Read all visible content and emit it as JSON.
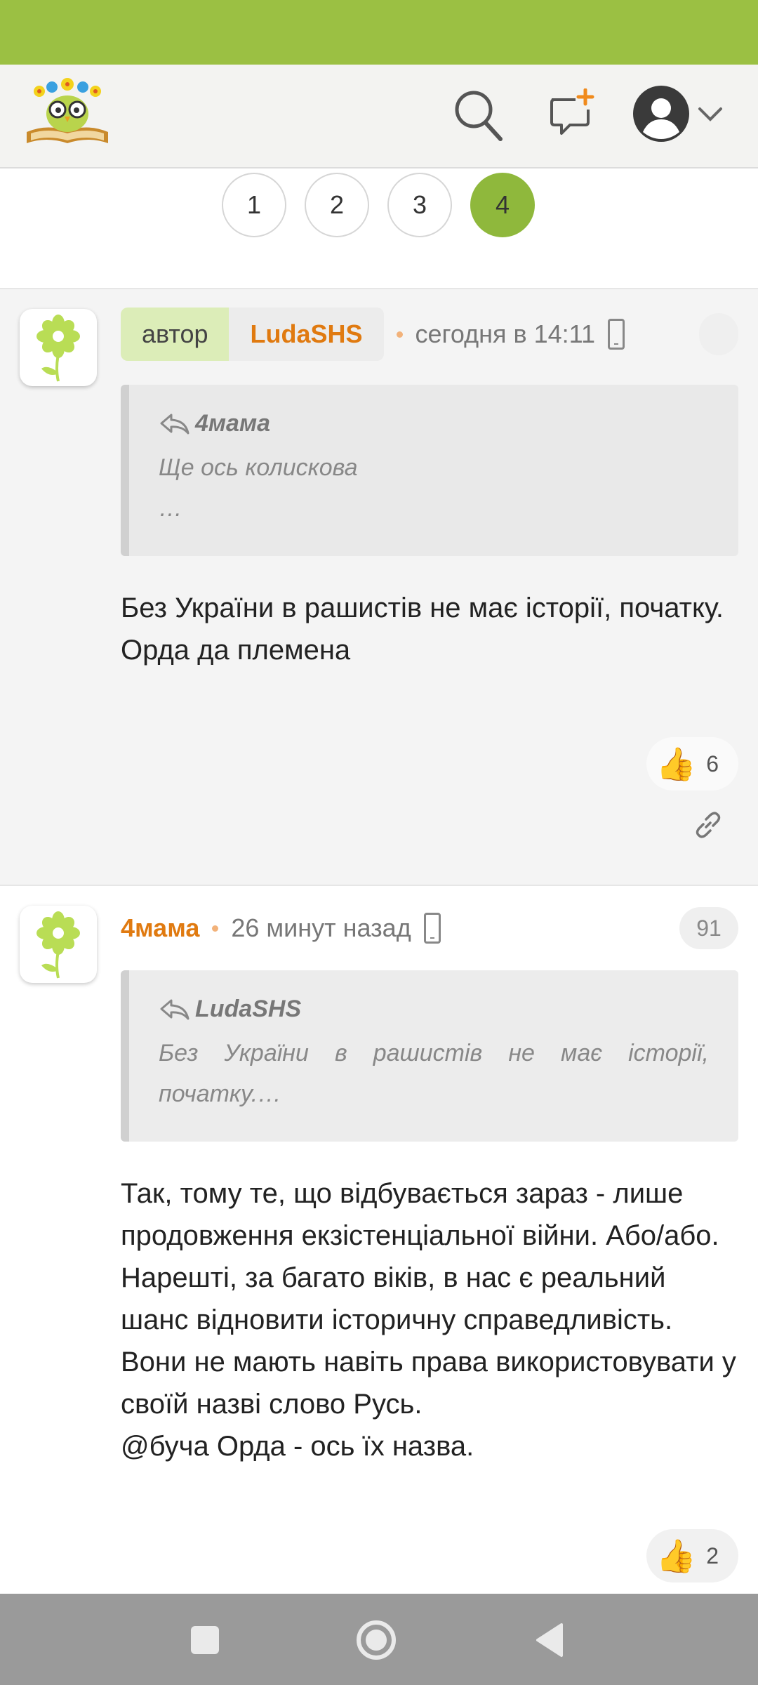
{
  "colors": {
    "status_bar": "#9bc043",
    "accent": "#8fb83c",
    "author_name": "#e07a10",
    "nav_bar": "#9a9a9a"
  },
  "header": {
    "logo_icon": "owl-book-logo-icon",
    "icons": [
      "search-icon",
      "new-message-icon",
      "user-avatar-icon",
      "chevron-down-icon"
    ]
  },
  "pagination": {
    "pages": [
      "1",
      "2",
      "3",
      "4"
    ],
    "active": "4"
  },
  "posts": [
    {
      "author_tag": "автор",
      "author": "LudaSHS",
      "time": "сегодня в 14:11",
      "quote_author": "4мама",
      "quote_line1": "Ще ось колискова",
      "quote_line2": "…",
      "body": "Без України в рашистів не має історії, початку.\nОрда да племена",
      "likes": "6"
    },
    {
      "author": "4мама",
      "time": "26 минут назад",
      "counter": "91",
      "quote_author": "LudaSHS",
      "quote_text": "Без України в рашистів не має історії, початку.…",
      "body": "Так, тому те, що відбувається зараз - лише продовження екзістенціальної війни. Або/або. Нарешті, за багато віків, в нас є реальний шанс відновити історичну справедливість. Вони не мають навіть права використовувати у своїй назві слово Русь.\n@буча Орда - ось їх назва.",
      "likes": "2"
    }
  ]
}
